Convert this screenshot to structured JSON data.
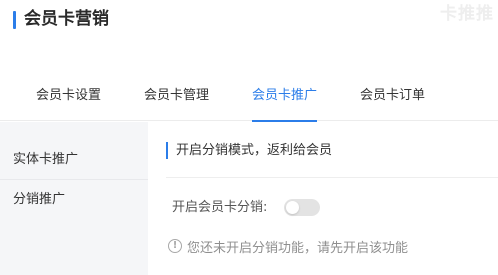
{
  "header": {
    "title": "会员卡营销",
    "watermark": "卡推推"
  },
  "tabs": [
    {
      "label": "会员卡设置",
      "active": false
    },
    {
      "label": "会员卡管理",
      "active": false
    },
    {
      "label": "会员卡推广",
      "active": true
    },
    {
      "label": "会员卡订单",
      "active": false
    }
  ],
  "sidebar": {
    "items": [
      {
        "label": "实体卡推广",
        "active": false
      },
      {
        "label": "分销推广",
        "active": true
      }
    ]
  },
  "main": {
    "section_title": "开启分销模式，返利给会员",
    "toggle_label": "开启会员卡分销:",
    "toggle_on": false,
    "notice_icon": "info-icon",
    "notice_icon_glyph": "!",
    "notice": "您还未开启分销功能，请先开启该功能"
  },
  "colors": {
    "accent": "#2b7de9",
    "sidebar_bg": "#f5f6f8",
    "toggle_off": "#e3e3e3",
    "muted_text": "#8f8f8f"
  }
}
